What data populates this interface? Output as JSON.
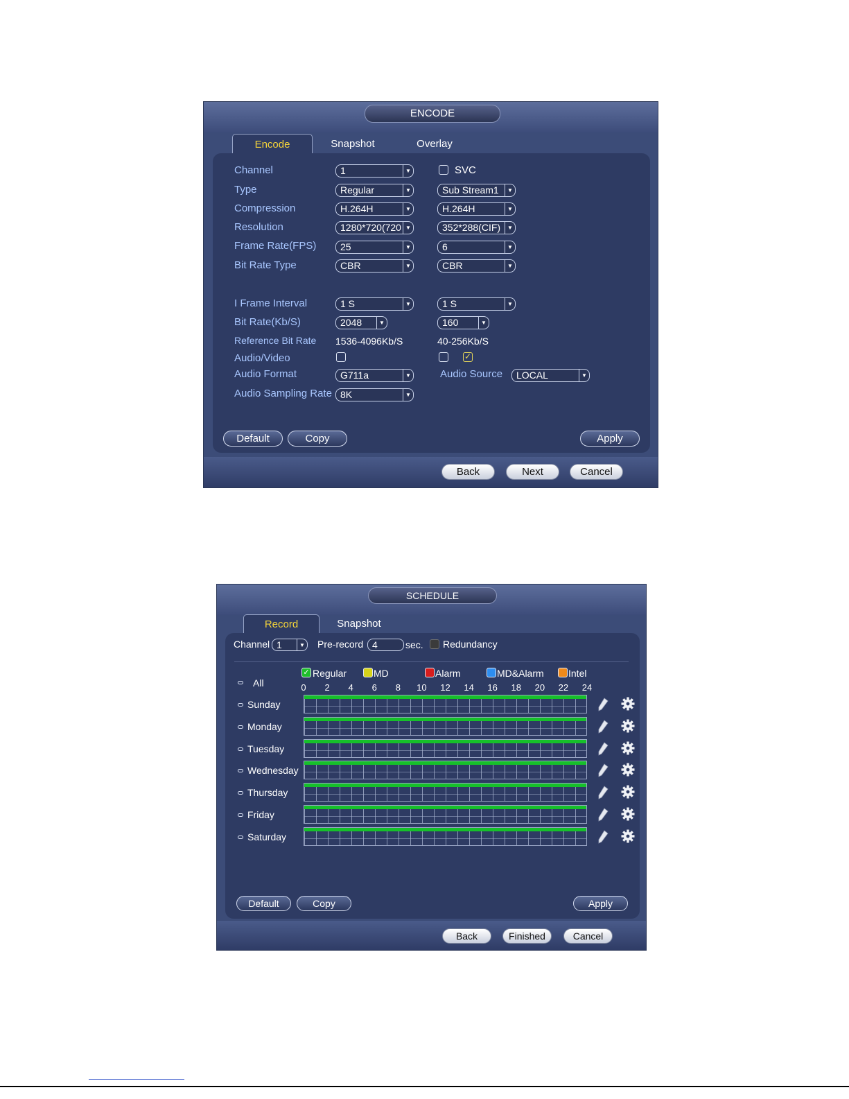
{
  "encode": {
    "title": "ENCODE",
    "tabs": [
      {
        "label": "Encode",
        "active": true
      },
      {
        "label": "Snapshot",
        "active": false
      },
      {
        "label": "Overlay",
        "active": false
      }
    ],
    "labels": {
      "channel": "Channel",
      "type": "Type",
      "compression": "Compression",
      "resolution": "Resolution",
      "frame_rate": "Frame Rate(FPS)",
      "bit_rate_type": "Bit Rate Type",
      "i_frame": "I Frame Interval",
      "bit_rate": "Bit Rate(Kb/S)",
      "ref_bit_rate": "Reference Bit Rate",
      "audio_video": "Audio/Video",
      "audio_format": "Audio Format",
      "audio_sampling": "Audio Sampling Rate",
      "audio_source": "Audio Source",
      "svc": "SVC"
    },
    "main": {
      "channel": "1",
      "type": "Regular",
      "compression": "H.264H",
      "resolution": "1280*720(720",
      "frame_rate": "25",
      "bit_rate_type": "CBR",
      "i_frame": "1 S",
      "bit_rate": "2048",
      "ref_bit_rate": "1536-4096Kb/S",
      "audio_video_checked": false,
      "audio_format": "G711a",
      "audio_sampling": "8K"
    },
    "sub": {
      "type": "Sub Stream1",
      "compression": "H.264H",
      "resolution": "352*288(CIF)",
      "frame_rate": "6",
      "bit_rate_type": "CBR",
      "i_frame": "1 S",
      "bit_rate": "160",
      "ref_bit_rate": "40-256Kb/S",
      "audio_video_checked": false,
      "audio_extra_checked": true,
      "audio_source": "LOCAL"
    },
    "buttons": {
      "default": "Default",
      "copy": "Copy",
      "apply": "Apply",
      "back": "Back",
      "next": "Next",
      "cancel": "Cancel"
    }
  },
  "schedule": {
    "title": "SCHEDULE",
    "tabs": [
      {
        "label": "Record",
        "active": true
      },
      {
        "label": "Snapshot",
        "active": false
      }
    ],
    "channel_label": "Channel",
    "channel_value": "1",
    "prerecord_label": "Pre-record",
    "prerecord_value": "4",
    "sec_label": "sec.",
    "redundancy_label": "Redundancy",
    "all_label": "All",
    "legend": [
      {
        "label": "Regular",
        "color": "#1fbf2c",
        "checked": true
      },
      {
        "label": "MD",
        "color": "#d6d21a",
        "checked": false
      },
      {
        "label": "Alarm",
        "color": "#d81d1d",
        "checked": false
      },
      {
        "label": "MD&Alarm",
        "color": "#2e8ef0",
        "checked": false
      },
      {
        "label": "Intel",
        "color": "#f08a1a",
        "checked": false
      }
    ],
    "hours": [
      "0",
      "2",
      "4",
      "6",
      "8",
      "10",
      "12",
      "14",
      "16",
      "18",
      "20",
      "22",
      "24"
    ],
    "days": [
      {
        "label": "Sunday",
        "recorded_fraction": 1.0
      },
      {
        "label": "Monday",
        "recorded_fraction": 1.0
      },
      {
        "label": "Tuesday",
        "recorded_fraction": 1.0
      },
      {
        "label": "Wednesday",
        "recorded_fraction": 1.0
      },
      {
        "label": "Thursday",
        "recorded_fraction": 1.0
      },
      {
        "label": "Friday",
        "recorded_fraction": 1.0
      },
      {
        "label": "Saturday",
        "recorded_fraction": 1.0
      }
    ],
    "buttons": {
      "default": "Default",
      "copy": "Copy",
      "apply": "Apply",
      "back": "Back",
      "finished": "Finished",
      "cancel": "Cancel"
    }
  }
}
